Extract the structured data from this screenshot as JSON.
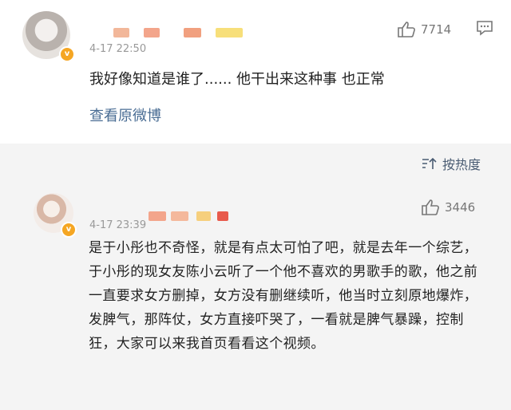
{
  "post": {
    "timestamp": "4-17 22:50",
    "like_count": "7714",
    "text": "我好像知道是谁了...... 他干出来这种事 也正常",
    "view_original": "查看原微博",
    "badge": "v"
  },
  "sort": {
    "label": "按热度"
  },
  "reply": {
    "timestamp": "4-17 23:39",
    "like_count": "3446",
    "badge": "v",
    "text": "是于小彤也不奇怪，就是有点太可怕了吧，就是去年一个综艺，于小彤的现女友陈小云听了一个他不喜欢的男歌手的歌，他之前一直要求女方删掉，女方没有删继续听，他当时立刻原地爆炸，发脾气，那阵仗，女方直接吓哭了，一看就是脾气暴躁，控制狂，大家可以来我首页看看这个视频。"
  },
  "colors": {
    "link": "#4a6d94",
    "badge": "#f5a623",
    "background_reply": "#f4f4f4"
  }
}
